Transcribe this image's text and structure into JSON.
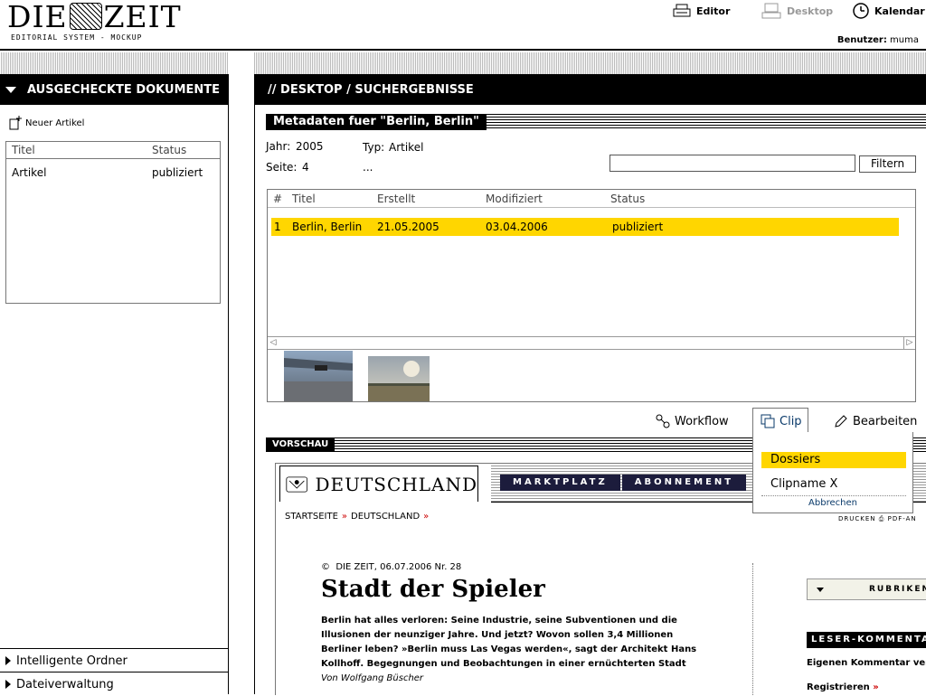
{
  "header": {
    "logo_left": "DIE",
    "logo_right": "ZEIT",
    "subtitle": "EDITORIAL SYSTEM - MOCKUP",
    "nav": [
      {
        "label": "Editor",
        "icon": "typewriter-icon",
        "disabled": false
      },
      {
        "label": "Desktop",
        "icon": "computer-icon",
        "disabled": true
      },
      {
        "label": "Kalendar",
        "icon": "clock-icon",
        "disabled": false
      }
    ],
    "user_label": "Benutzer:",
    "user_name": "muma"
  },
  "sidebar": {
    "title": "AUSGECHECKTE DOKUMENTE",
    "new_article": "Neuer Artikel",
    "table": {
      "headers": [
        "Titel",
        "Status"
      ],
      "rows": [
        {
          "title": "Artikel",
          "status": "publiziert"
        }
      ]
    },
    "footer_items": [
      "Intelligente Ordner",
      "Dateiverwaltung"
    ]
  },
  "main": {
    "title": "// DESKTOP / SUCHERGEBNISSE",
    "metadata_title": "Metadaten fuer \"Berlin, Berlin\"",
    "meta": {
      "jahr_label": "Jahr:",
      "jahr": "2005",
      "typ_label": "Typ:",
      "typ": "Artikel",
      "seite_label": "Seite:",
      "seite": "4",
      "more": "..."
    },
    "search": {
      "value": "",
      "placeholder": ""
    },
    "filter_button": "Filtern",
    "results": {
      "headers": [
        "#",
        "Titel",
        "Erstellt",
        "Modifiziert",
        "Status"
      ],
      "rows": [
        {
          "num": "1",
          "title": "Berlin, Berlin",
          "created": "21.05.2005",
          "modified": "03.04.2006",
          "status": "publiziert"
        }
      ]
    },
    "actions": {
      "workflow": "Workflow",
      "clip": "Clip",
      "bearbeiten": "Bearbeiten"
    },
    "preview_label": "VORSCHAU"
  },
  "preview": {
    "logo": "DEUTSCHLAND",
    "nav": [
      "MARKTPLATZ",
      "ABONNEMENT"
    ],
    "crumbs": [
      "STARTSEITE",
      "DEUTSCHLAND"
    ],
    "crumb_sep": "»",
    "print_label": "DRUCKEN",
    "pdf_label": "PDF-AN",
    "date": "DIE ZEIT, 06.07.2006 Nr. 28",
    "copyright": "©",
    "title": "Stadt der Spieler",
    "lead": "Berlin hat alles verloren: Seine Industrie, seine Subventionen und die Illusionen der neunziger Jahre. Und jetzt? Wovon sollen 3,4 Millionen Berliner leben? »Berlin muss Las Vegas werden«, sagt der Architekt Hans Kollhoff. Begegnungen und Beobachtungen in einer ernüchterten Stadt",
    "author": "Von Wolfgang Büscher",
    "rubriken": "RUBRIKEN",
    "leser": "LESER-KOMMENTA",
    "eigenen": "Eigenen Kommentar ver",
    "registrieren": "Registrieren",
    "reg_arrow": "»"
  },
  "clip_dropdown": {
    "items": [
      "Dossiers",
      "Clipname X"
    ],
    "selected": "Dossiers",
    "cancel": "Abbrechen"
  },
  "colors": {
    "highlight": "#ffd600",
    "black": "#000000",
    "link": "#0a3a6a",
    "nav_dark": "#1c1c3c"
  }
}
